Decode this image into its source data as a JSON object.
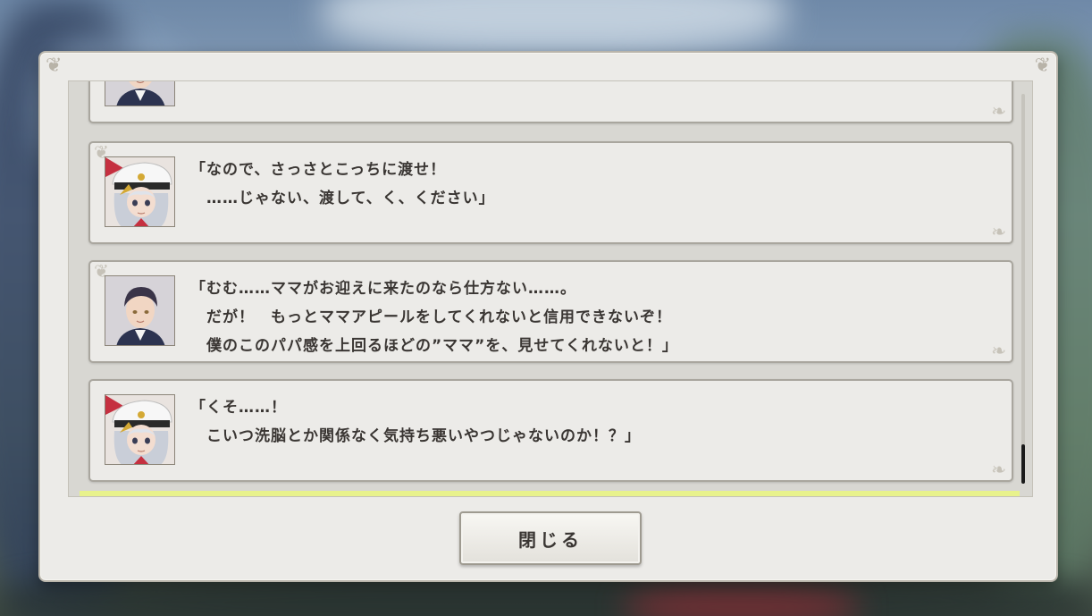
{
  "dialog": {
    "close_label": "閉じる"
  },
  "log": {
    "entries": [
      {
        "speaker": "father-character",
        "lines": []
      },
      {
        "speaker": "girl-officer-character",
        "lines": [
          "「なので、さっさとこっちに渡せ！",
          "　……じゃない、渡して、く、ください」"
        ]
      },
      {
        "speaker": "father-character",
        "lines": [
          "「むむ……ママがお迎えに来たのなら仕方ない……。",
          "　だが！　もっとママアピールをしてくれないと信用できないぞ！",
          "　僕のこのパパ感を上回るほどの”ママ”を、見せてくれないと！」"
        ]
      },
      {
        "speaker": "girl-officer-character",
        "lines": [
          "「くそ……！",
          "　こいつ洗脳とか関係なく気持ち悪いやつじゃないのか！？」"
        ]
      }
    ]
  },
  "colors": {
    "panel": "#ecebe8",
    "text": "#3a3633",
    "highlight": "#e8f28c"
  }
}
